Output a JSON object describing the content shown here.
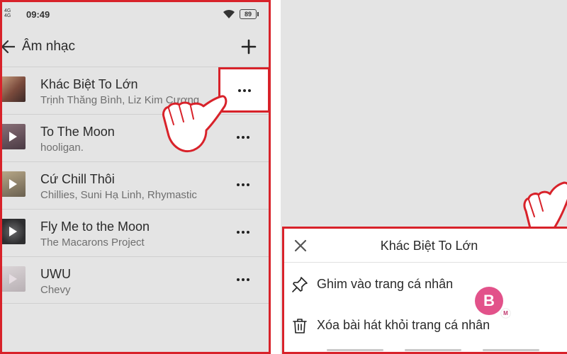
{
  "status_bar": {
    "network": "4G\n4G",
    "time": "09:49",
    "battery": "89"
  },
  "app_bar": {
    "back_icon": "arrow-left-icon",
    "title": "Âm nhạc",
    "add_icon": "plus-icon"
  },
  "songs": [
    {
      "title": "Khác Biệt To Lớn",
      "artist": "Trịnh Thăng Bình, Liz Kim Cương",
      "thumb_color": "#8a5a4a"
    },
    {
      "title": "To The Moon",
      "artist": "hooligan.",
      "thumb_color": "#5a4a52"
    },
    {
      "title": "Cứ Chill Thôi",
      "artist": "Chillies, Suni Hạ Linh, Rhymastic",
      "thumb_color": "#8c7f6a"
    },
    {
      "title": "Fly Me to the Moon",
      "artist": "The Macarons Project",
      "thumb_color": "#3e3e40"
    },
    {
      "title": "UWU",
      "artist": "Chevy",
      "thumb_color": "#c9c4c6"
    }
  ],
  "more_icon": "more-horizontal-icon",
  "sheet": {
    "title": "Khác Biệt To Lớn",
    "close_icon": "close-icon",
    "items": [
      {
        "label": "Ghim vào trang cá nhân",
        "icon": "pin-icon"
      },
      {
        "label": "Xóa bài hát khỏi trang cá nhân",
        "icon": "trash-icon"
      }
    ],
    "bubble_letter": "B",
    "bubble_badge": "M"
  },
  "colors": {
    "highlight": "#d8222a",
    "background": "#e4e4e4",
    "bubble": "#e2528a"
  }
}
